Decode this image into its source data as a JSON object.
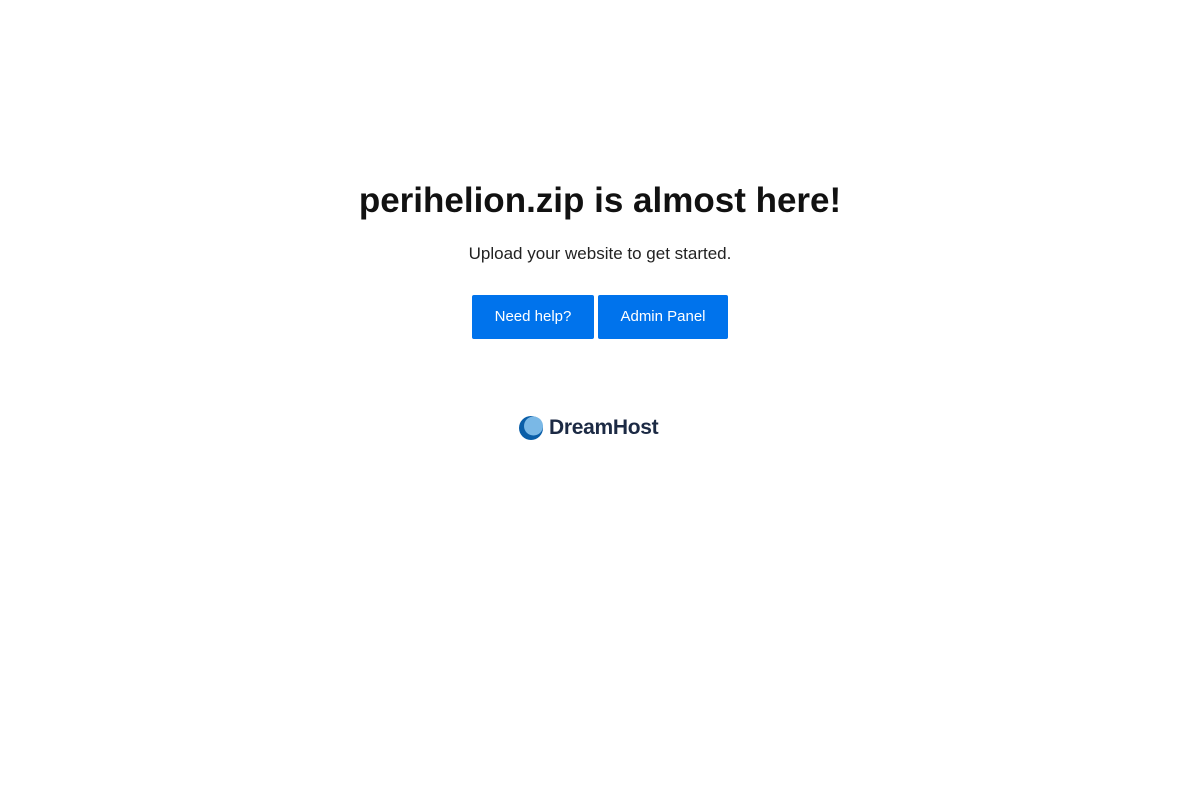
{
  "main": {
    "headline": "perihelion.zip is almost here!",
    "subtitle": "Upload your website to get started."
  },
  "buttons": {
    "help_label": "Need help?",
    "admin_label": "Admin Panel"
  },
  "footer": {
    "logo_text": "DreamHost",
    "logo_icon": "dreamhost-moon-icon"
  },
  "colors": {
    "button_bg": "#0073ec",
    "button_text": "#ffffff",
    "logo_text": "#1c2a44",
    "logo_mark_light": "#7ab8e6",
    "logo_mark_dark": "#0a5ea8"
  }
}
